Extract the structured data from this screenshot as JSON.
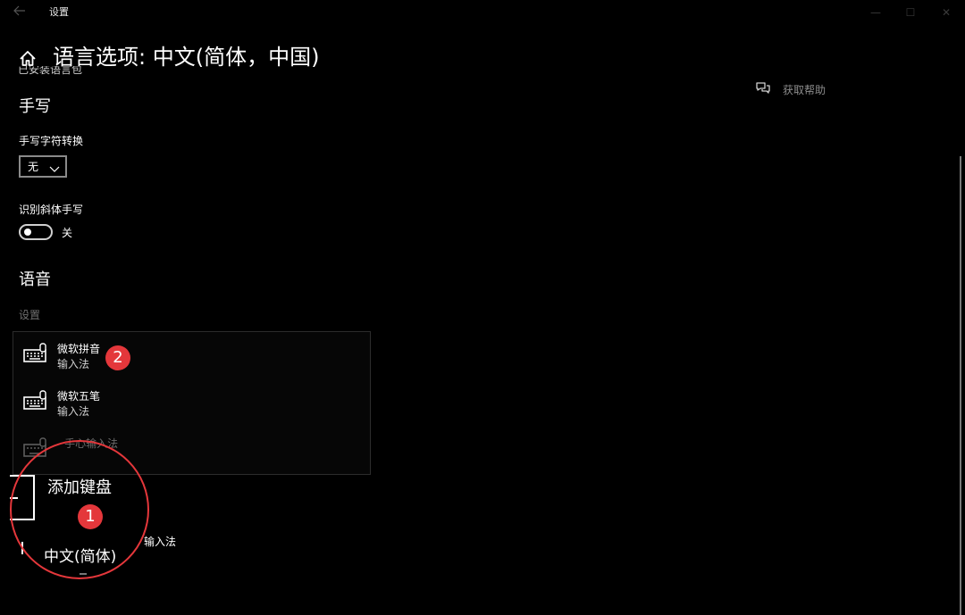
{
  "window": {
    "app_title": "设置",
    "back_icon": "arrow-left-icon",
    "minimize_glyph": "—",
    "maximize_glyph": "☐",
    "close_glyph": "✕"
  },
  "header": {
    "home_icon": "home-icon",
    "title": "语言选项: 中文(简体，中国)",
    "clipped_text": "已安装语言包"
  },
  "handwriting": {
    "section_title": "手写",
    "conversion_label": "手写字符转换",
    "conversion_value": "无",
    "italic_label": "识别斜体手写",
    "italic_state": "关"
  },
  "voice": {
    "section_title": "语音",
    "settings_label": "设置"
  },
  "keyboards": [
    {
      "name": "微软拼音",
      "sub": "输入法",
      "icon": "keyboard-icon"
    },
    {
      "name": "微软五笔",
      "sub": "输入法",
      "icon": "keyboard-icon"
    },
    {
      "name": "- 手心输入法",
      "sub": "",
      "icon": "keyboard-icon"
    }
  ],
  "add_keyboard": {
    "label": "添加键盘",
    "partial_ime": "输入法",
    "lang_label": "中文(简体)"
  },
  "badges": {
    "step1": "1",
    "step2": "2"
  },
  "help": {
    "icon": "chat-help-icon",
    "label": "获取帮助"
  },
  "colors": {
    "background": "#000000",
    "accent_red": "#e4373b",
    "muted_text": "#8c8c8c"
  }
}
